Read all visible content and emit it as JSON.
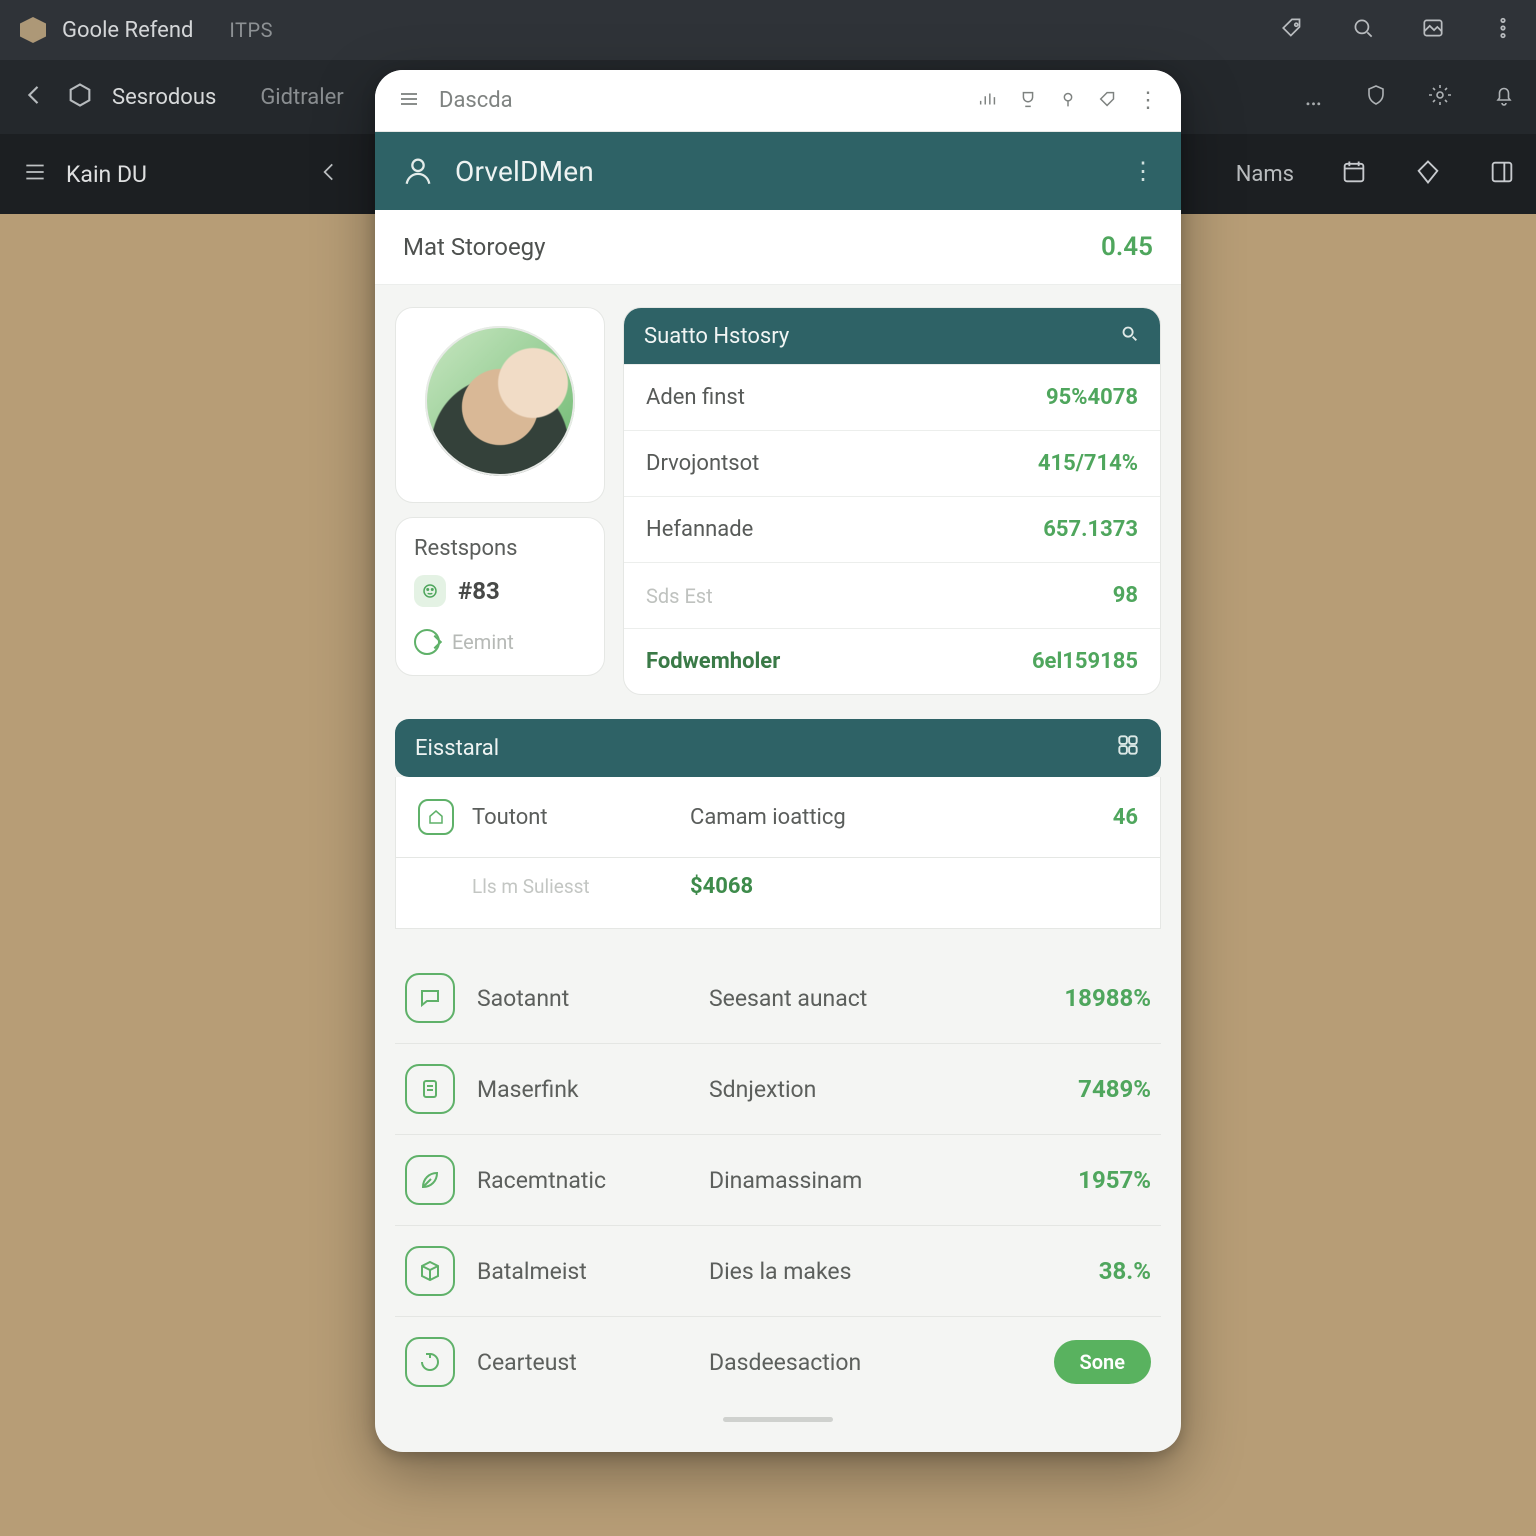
{
  "chrome": {
    "app_name": "Goole Refend",
    "tab_label": "ITPS",
    "sub": {
      "crumb1": "Sesrodous",
      "crumb2": "Gidtraler",
      "dots": "…"
    },
    "third": {
      "title": "Kain DU",
      "right_label": "Nams"
    }
  },
  "panel": {
    "top_title": "Dascda",
    "hero_name": "OrvelDMen",
    "summary": {
      "label": "Mat Storoegy",
      "value": "0.45"
    },
    "side": {
      "heading": "Restspons",
      "stat": "#83",
      "footer": "Eemint"
    },
    "history": {
      "header": "Suatto Hstosry",
      "rows": [
        {
          "k": "Aden finst",
          "v": "95%4078"
        },
        {
          "k": "Drvojontsot",
          "v": "415/714%"
        },
        {
          "k": "Hefannade",
          "v": "657.1373"
        },
        {
          "k_dim": "Sds Est",
          "v": "98"
        },
        {
          "k_bold": "Fodwemholer",
          "v": "6el159185"
        }
      ]
    },
    "section": {
      "header": "Eisstaral"
    },
    "cat": {
      "row": {
        "label": "Toutont",
        "mid": "Camam ioatticg",
        "val": "46"
      },
      "sub": {
        "label": "Lls m Suliesst",
        "mid": "$4068"
      }
    },
    "list": [
      {
        "icon": "chat-icon",
        "l": "Saotannt",
        "m": "Seesant aunact",
        "v": "18988%"
      },
      {
        "icon": "note-icon",
        "l": "Maserfink",
        "m": "Sdnjextion",
        "v": "7489%"
      },
      {
        "icon": "leaf-icon",
        "l": "Racemtnatic",
        "m": "Dinamassinam",
        "v": "1957%"
      },
      {
        "icon": "cube-icon",
        "l": "Batalmeist",
        "m": "Dies la makes",
        "v": "38.%"
      },
      {
        "icon": "loop-icon",
        "l": "Cearteust",
        "m": "Dasdeesaction",
        "pill": "Sone"
      }
    ]
  }
}
